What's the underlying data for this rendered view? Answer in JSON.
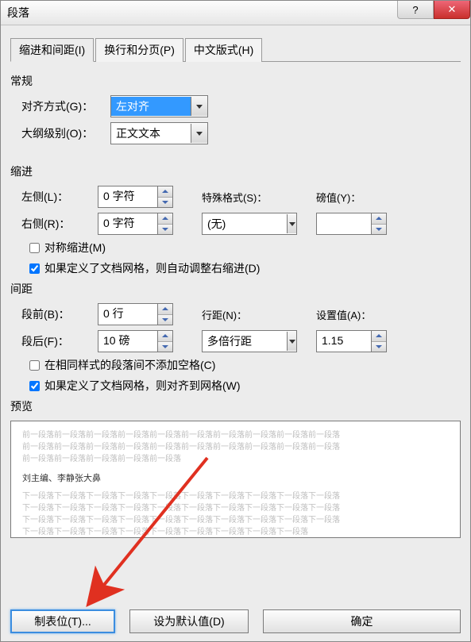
{
  "window": {
    "title": "段落"
  },
  "titlebar": {
    "help_icon": "?",
    "close_icon": "✕"
  },
  "tabs": [
    {
      "label": "缩进和间距(I)",
      "active": true
    },
    {
      "label": "换行和分页(P)",
      "active": false
    },
    {
      "label": "中文版式(H)",
      "active": false
    }
  ],
  "sections": {
    "general": "常规",
    "indent": "缩进",
    "spacing": "间距",
    "preview": "预览"
  },
  "general": {
    "alignment_label": "对齐方式(G)：",
    "alignment_value": "左对齐",
    "outline_label": "大纲级别(O)：",
    "outline_value": "正文文本"
  },
  "indent": {
    "left_label": "左侧(L)：",
    "left_value": "0 字符",
    "right_label": "右侧(R)：",
    "right_value": "0 字符",
    "special_label": "特殊格式(S)：",
    "special_value": "(无)",
    "by_label": "磅值(Y)：",
    "by_value": "",
    "mirror_label": "对称缩进(M)",
    "mirror_checked": false,
    "autoadjust_label": "如果定义了文档网格，则自动调整右缩进(D)",
    "autoadjust_checked": true
  },
  "spacing": {
    "before_label": "段前(B)：",
    "before_value": "0 行",
    "after_label": "段后(F)：",
    "after_value": "10 磅",
    "linespace_label": "行距(N)：",
    "linespace_value": "多倍行距",
    "at_label": "设置值(A)：",
    "at_value": "1.15",
    "noaddspace_label": "在相同样式的段落间不添加空格(C)",
    "noaddspace_checked": false,
    "snapgrid_label": "如果定义了文档网格，则对齐到网格(W)",
    "snapgrid_checked": true
  },
  "preview": {
    "filler": "前一段落前一段落前一段落前一段落前一段落前一段落前一段落前一段落前一段落前一段落",
    "filler2": "前一段落前一段落前一段落前一段落前一段落",
    "sample": "刘主编、李静张大鼻",
    "filler3": "下一段落下一段落下一段落下一段落下一段落下一段落下一段落下一段落下一段落下一段落",
    "filler4": "下一段落下一段落下一段落下一段落下一段落下一段落下一段落下一段落下一段落下一段落",
    "filler5": "下一段落下一段落下一段落下一段落下一段落下一段落下一段落下一段落下一段落"
  },
  "buttons": {
    "tabstops": "制表位(T)...",
    "setdefault": "设为默认值(D)",
    "ok": "确定"
  }
}
